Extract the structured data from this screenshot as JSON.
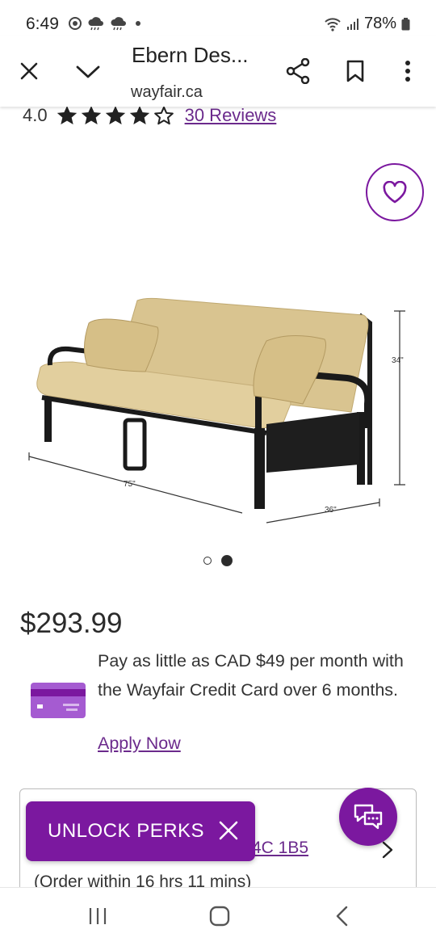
{
  "status_bar": {
    "time": "6:49",
    "battery": "78%"
  },
  "browser": {
    "page_title": "Ebern Des...",
    "url": "wayfair.ca",
    "icons": [
      "close-icon",
      "chevron-down-icon",
      "share-icon",
      "bookmark-icon",
      "more-vert-icon"
    ]
  },
  "rating": {
    "value": "4.0",
    "stars": 4,
    "max_stars": 5,
    "reviews_label": "30 Reviews"
  },
  "gallery": {
    "dimensions": {
      "height": "34\"",
      "width": "75\"",
      "depth": "36\""
    },
    "current_image": 2,
    "total_images": 2
  },
  "price": {
    "amount": "$293.99",
    "finance_text": "Pay as little as CAD $49 per month with the Wayfair Credit Card over 6 months.",
    "apply_label": "Apply Now"
  },
  "delivery": {
    "postal_code": "4C 1B5",
    "order_within": "(Order within 16 hrs 11 mins)"
  },
  "promo": {
    "unlock_label": "UNLOCK PERKS"
  },
  "colors": {
    "brand_purple": "#7b189f",
    "link_purple": "#6b2a8c"
  }
}
